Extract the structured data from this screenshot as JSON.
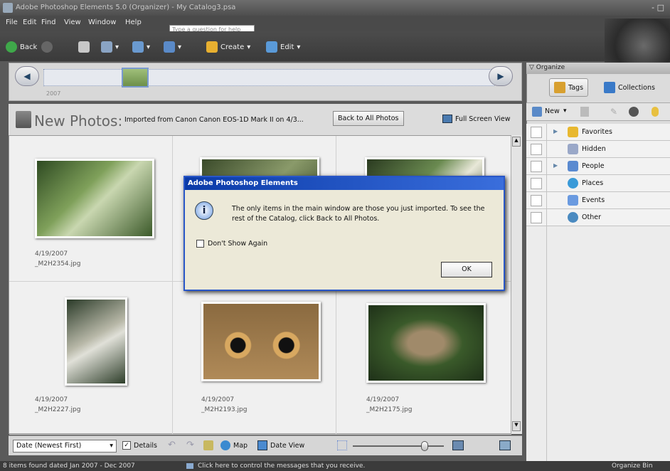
{
  "window": {
    "title": "Adobe Photoshop Elements 5.0 (Organizer) - My Catalog3.psa",
    "controls": "- □"
  },
  "menu": {
    "items": [
      "File",
      "Edit",
      "Find",
      "View",
      "Window",
      "Help"
    ],
    "help_placeholder": "Type a question for help"
  },
  "toolbar": {
    "back": "Back",
    "create": "Create",
    "edit": "Edit"
  },
  "timeline": {
    "year": "2007"
  },
  "header": {
    "title": "New Photos:",
    "subtitle": "Imported from Canon Canon EOS-1D Mark II on 4/3...",
    "back_button": "Back to All Photos",
    "fullscreen_button": "Full Screen View"
  },
  "photos": [
    {
      "date": "4/19/2007",
      "file": "_M2H2354.jpg"
    },
    {
      "date": "",
      "file": ""
    },
    {
      "date": "",
      "file": ""
    },
    {
      "date": "4/19/2007",
      "file": "_M2H2227.jpg"
    },
    {
      "date": "4/19/2007",
      "file": "_M2H2193.jpg"
    },
    {
      "date": "4/19/2007",
      "file": "_M2H2175.jpg"
    }
  ],
  "bottom": {
    "sort": "Date (Newest First)",
    "details": "Details",
    "map": "Map",
    "date_view": "Date View"
  },
  "status": {
    "left": "8 items found dated Jan 2007 - Dec 2007",
    "message": "Click here to control the messages that you receive.",
    "right": "Organize Bin"
  },
  "organize": {
    "header": "Organize",
    "tabs": [
      "Tags",
      "Collections"
    ],
    "new_label": "New"
  },
  "tags": [
    {
      "label": "Favorites",
      "expand": true,
      "color": "#e8b830"
    },
    {
      "label": "Hidden",
      "expand": false,
      "color": "#9aa8c8"
    },
    {
      "label": "People",
      "expand": true,
      "color": "#5a8ad0"
    },
    {
      "label": "Places",
      "expand": false,
      "color": "#3a9ad8"
    },
    {
      "label": "Events",
      "expand": false,
      "color": "#6a9ae0"
    },
    {
      "label": "Other",
      "expand": false,
      "color": "#4a8ac0"
    }
  ],
  "dialog": {
    "title": "Adobe Photoshop Elements",
    "message": "The only items in the main window are those you just imported. To see the rest of the Catalog, click Back to All Photos.",
    "checkbox": "Don't Show Again",
    "ok": "OK"
  }
}
